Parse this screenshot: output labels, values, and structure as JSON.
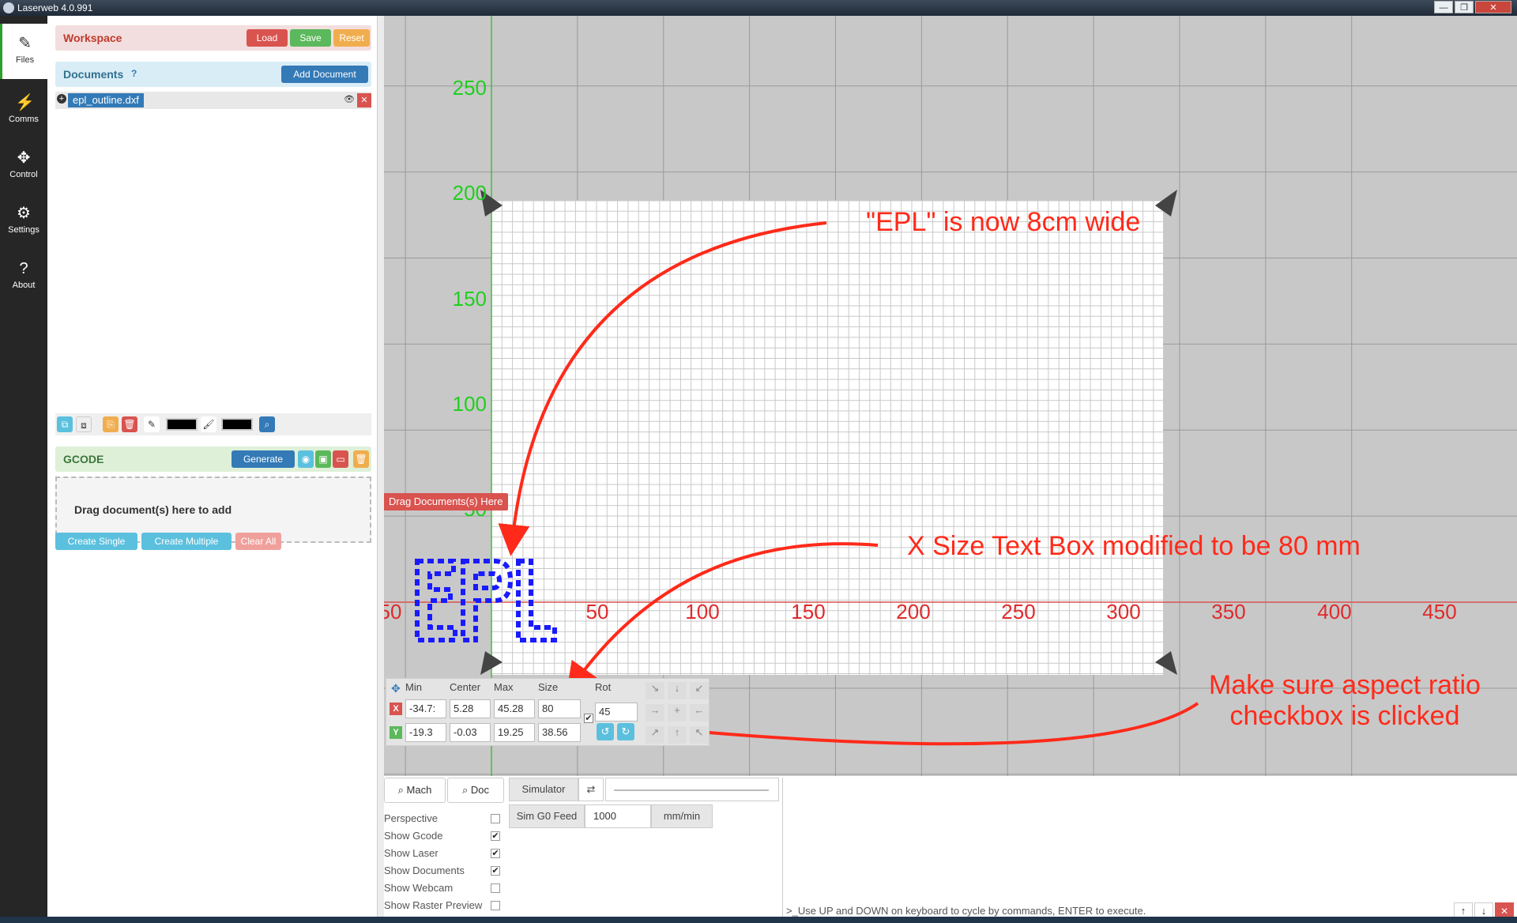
{
  "window": {
    "title": "Laserweb 4.0.991",
    "min": "—",
    "max": "❐",
    "close": "✕"
  },
  "rail": [
    {
      "label": "Files",
      "icon": "✎"
    },
    {
      "label": "Comms",
      "icon": "⚡"
    },
    {
      "label": "Control",
      "icon": "✥"
    },
    {
      "label": "Settings",
      "icon": "⚙"
    },
    {
      "label": "About",
      "icon": "?"
    }
  ],
  "workspace": {
    "title": "Workspace",
    "load": "Load",
    "save": "Save",
    "reset": "Reset"
  },
  "documents": {
    "title": "Documents",
    "help": "?",
    "add": "Add Document",
    "file": "epl_outline.dxf",
    "expand": "+",
    "eye": "👁",
    "remove": "✕"
  },
  "gcode": {
    "title": "GCODE",
    "generate": "Generate",
    "drop_hint": "Drag document(s) here to add",
    "drag_tag": "Drag Documents(s) Here",
    "create_single": "Create Single",
    "create_multiple": "Create Multiple",
    "clear_all": "Clear All"
  },
  "canvas": {
    "y_ticks": [
      "250",
      "200",
      "150",
      "100",
      "50"
    ],
    "x_ticks": [
      "50",
      "50",
      "100",
      "150",
      "200",
      "250",
      "300",
      "350",
      "400",
      "450"
    ]
  },
  "size_editor": {
    "headers": {
      "min": "Min",
      "center": "Center",
      "max": "Max",
      "size": "Size",
      "rot": "Rot"
    },
    "x": {
      "label": "X",
      "min": "-34.7:",
      "center": "5.28",
      "max": "45.28",
      "size": "80"
    },
    "y": {
      "label": "Y",
      "min": "-19.3",
      "center": "-0.03",
      "max": "19.25",
      "size": "38.56"
    },
    "rot": "45",
    "aspect_locked": "✔"
  },
  "bottom": {
    "mach_tab": "Mach",
    "doc_tab": "Doc",
    "simulator": "Simulator",
    "sim_feed_label": "Sim G0 Feed",
    "sim_feed_value": "1000",
    "sim_feed_unit": "mm/min",
    "options": [
      {
        "label": "Perspective",
        "checked": ""
      },
      {
        "label": "Show Gcode",
        "checked": "✔"
      },
      {
        "label": "Show Laser",
        "checked": "✔"
      },
      {
        "label": "Show Documents",
        "checked": "✔"
      },
      {
        "label": "Show Webcam",
        "checked": ""
      },
      {
        "label": "Show Raster Preview",
        "checked": ""
      }
    ],
    "console_hint": ">_Use UP and DOWN on keyboard to cycle by commands, ENTER to execute.",
    "console_up": "↑",
    "console_down": "↓",
    "console_clear": "✕"
  },
  "annotations": {
    "a1": "\"EPL\" is now 8cm wide",
    "a2": "X Size Text Box modified to be 80 mm",
    "a3_line1": "Make sure aspect ratio",
    "a3_line2": "checkbox is clicked"
  },
  "colors": {
    "accent_green": "#2ca02c",
    "axis_red": "#d9534f",
    "annotation": "#ff2a1a",
    "doc_blue": "#1a1aff"
  }
}
